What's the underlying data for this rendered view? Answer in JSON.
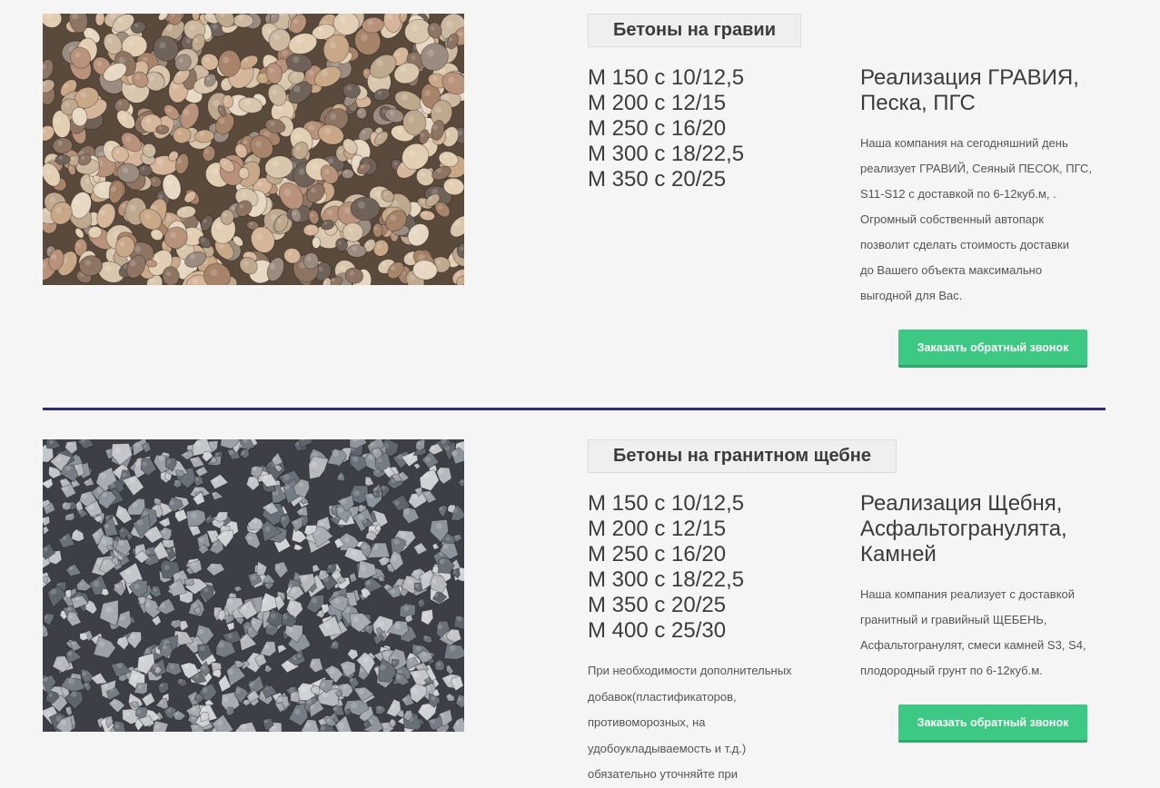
{
  "colors": {
    "background": "#f5f5f5",
    "divider": "#2d2b77",
    "button": "#3dc983",
    "button_shadow": "#2fa869",
    "title_box": "#efefef"
  },
  "sections": [
    {
      "title": "Бетоны на гравии",
      "grades": [
        "М 150 с 10/12,5",
        "М 200 с 12/15",
        "М 250 с 16/20",
        "М 300 с 18/22,5",
        "М 350 с 20/25"
      ],
      "heading_lines": [
        "Реализация ГРАВИЯ,",
        "Песка, ПГС"
      ],
      "paragraph_lines": [
        "Наша компания на сегодняшний день",
        "реализует ГРАВИЙ, Сеяный ПЕСОК, ПГС,",
        "S11-S12 с доставкой по 6-12куб.м, .",
        "Огромный собственный автопарк",
        "позволит сделать стоимость доставки",
        "до Вашего объекта максимально",
        "выгодной для Вас."
      ],
      "button_label": "Заказать обратный звонок",
      "image": "gravel-photo"
    },
    {
      "title": "Бетоны на гранитном щебне",
      "grades": [
        "М 150 с 10/12,5",
        "М 200 с 12/15",
        "М 250 с 16/20",
        "М 300 с 18/22,5",
        "М 350 с 20/25",
        "М 400 с 25/30"
      ],
      "heading_lines": [
        "Реализация Щебня,",
        "Асфальтогранулята,",
        "Камней"
      ],
      "paragraph_lines": [
        "Наша компания реализует с доставкой",
        "гранитный и гравийный ЩЕБЕНЬ,",
        "Асфальтогранулят, смеси камней S3, S4,",
        "плодородный грунт по 6-12куб.м."
      ],
      "button_label": "Заказать обратный звонок",
      "note_lines": [
        "При необходимости дополнительных",
        "добавок(пластификаторов,",
        "противоморозных, на",
        "удобоукладываемость и т.д.)",
        "обязательно уточняйте при"
      ],
      "image": "granite-crushed-stone-photo"
    }
  ]
}
